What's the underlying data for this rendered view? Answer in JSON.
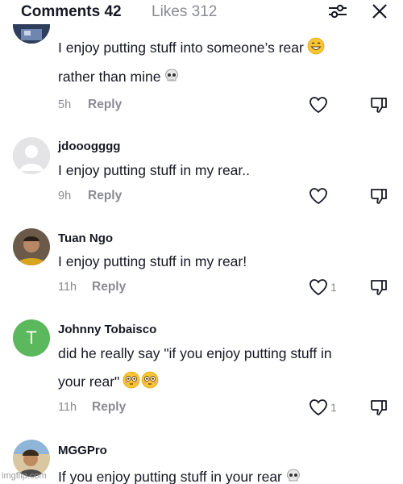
{
  "header": {
    "comments_tab": "Comments 42",
    "likes_tab": "Likes 312",
    "filter_icon": "sliders-icon",
    "close_icon": "close-icon"
  },
  "comments": [
    {
      "lines": [
        "I enjoy putting stuff into someone’s rear",
        "rather than mine"
      ],
      "time": "5h",
      "reply": "Reply",
      "likes": ""
    },
    {
      "name": "jdooogggg",
      "lines": [
        "I enjoy putting stuff in my rear.."
      ],
      "time": "9h",
      "reply": "Reply",
      "likes": ""
    },
    {
      "name": "Tuan Ngo",
      "lines": [
        "I enjoy putting stuff in my rear!"
      ],
      "time": "11h",
      "reply": "Reply",
      "likes": "1"
    },
    {
      "name": "Johnny Tobaisco",
      "avatar_letter": "T",
      "lines": [
        "did he really say \"if you enjoy putting stuff in",
        "your rear\""
      ],
      "time": "11h",
      "reply": "Reply",
      "likes": "1"
    },
    {
      "name": "MGGPro",
      "lines": [
        "If you enjoy putting stuff in your rear"
      ]
    }
  ],
  "watermark": "imgflip.com",
  "colors": {
    "text": "#161823",
    "muted": "#8a8b91",
    "avatar_green": "#5cb85c"
  }
}
